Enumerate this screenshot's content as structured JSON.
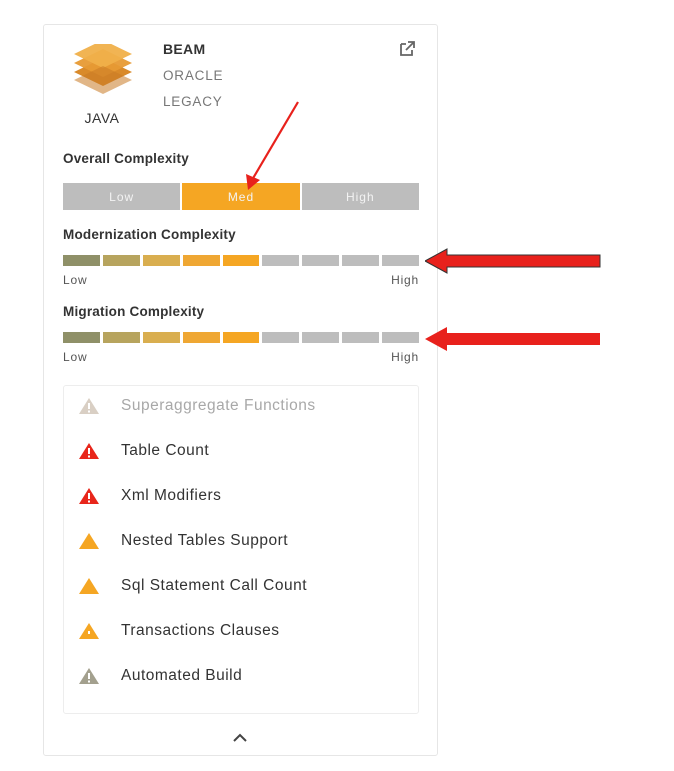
{
  "header": {
    "language": "JAVA",
    "name": "BEAM",
    "tags": [
      "ORACLE",
      "LEGACY"
    ],
    "open_icon": "external-link-icon"
  },
  "overall": {
    "title": "Overall Complexity",
    "levels": [
      "Low",
      "Med",
      "High"
    ],
    "selected": "Med"
  },
  "modernization": {
    "title": "Modernization Complexity",
    "filled_segments": 5,
    "total_segments": 9,
    "low_label": "Low",
    "high_label": "High"
  },
  "migration": {
    "title": "Migration Complexity",
    "filled_segments": 5,
    "total_segments": 9,
    "low_label": "Low",
    "high_label": "High"
  },
  "findings": [
    {
      "label": "Superaggregate Functions",
      "severity": "muted",
      "icon": "warning-icon"
    },
    {
      "label": "Table Count",
      "severity": "critical",
      "icon": "warning-icon"
    },
    {
      "label": "Xml Modifiers",
      "severity": "critical",
      "icon": "warning-icon"
    },
    {
      "label": "Nested Tables Support",
      "severity": "medium",
      "icon": "warning-icon"
    },
    {
      "label": "Sql Statement Call Count",
      "severity": "medium",
      "icon": "warning-icon"
    },
    {
      "label": "Transactions Clauses",
      "severity": "medium",
      "icon": "warning-icon"
    },
    {
      "label": "Automated Build",
      "severity": "low",
      "icon": "warning-icon"
    }
  ],
  "colors": {
    "accent": "#f5a623",
    "inactive": "#bdbdbd",
    "critical": "#e8261b",
    "annotation_arrow": "#e8211c",
    "bar_gradient": [
      "#8f9068",
      "#b7a45e",
      "#d9ae4f",
      "#efa733",
      "#f5a623"
    ]
  }
}
